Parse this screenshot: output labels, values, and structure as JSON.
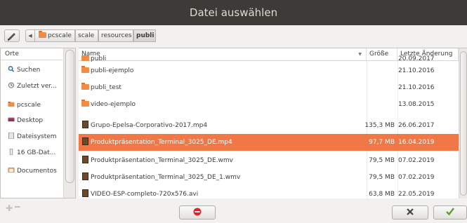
{
  "window": {
    "title": "Datei auswählen"
  },
  "pathbar": {
    "edit_icon": "pencil-icon",
    "back_icon": "chevron-left-icon",
    "crumbs": [
      "pcscale",
      "scale",
      "resources",
      "publi"
    ]
  },
  "sidebar": {
    "header": "Orte",
    "items": [
      {
        "label": "Suchen",
        "icon": "search-icon"
      },
      {
        "label": "Zuletzt ver...",
        "icon": "recent-icon"
      },
      {
        "label": "pcscale",
        "icon": "home-folder-icon"
      },
      {
        "label": "Desktop",
        "icon": "desktop-icon"
      },
      {
        "label": "Dateisystem",
        "icon": "harddisk-icon"
      },
      {
        "label": "16 GB-Dat...",
        "icon": "usb-drive-icon"
      },
      {
        "label": "Documentos",
        "icon": "documents-icon"
      }
    ],
    "add_icon": "plus-icon",
    "remove_icon": "minus-icon"
  },
  "filelist": {
    "columns": {
      "name": "Name",
      "size": "Größe",
      "modified": "Letzte Änderung"
    },
    "partial_row": {
      "name": "publi",
      "date": "20.09.2017"
    },
    "rows": [
      {
        "type": "folder",
        "name": "publi-ejemplo",
        "size": "",
        "date": "21.10.2016",
        "selected": false
      },
      {
        "type": "folder",
        "name": "publi_test",
        "size": "",
        "date": "21.10.2016",
        "selected": false
      },
      {
        "type": "folder",
        "name": "video-ejemplo",
        "size": "",
        "date": "13.08.2015",
        "selected": false
      },
      {
        "type": "video",
        "name": "Grupo-Epelsa-Corporativo-2017.mp4",
        "size": "135,3 MB",
        "date": "26.06.2017",
        "selected": false
      },
      {
        "type": "video",
        "name": "Produktpräsentation_Terminal_3025_DE.mp4",
        "size": "97,7 MB",
        "date": "16.04.2019",
        "selected": true
      },
      {
        "type": "video",
        "name": "Produktpräsentation_Terminal_3025_DE.wmv",
        "size": "79,5 MB",
        "date": "07.02.2019",
        "selected": false
      },
      {
        "type": "video",
        "name": "Produktpräsentation_Terminal_3025_DE_1.wmv",
        "size": "79,5 MB",
        "date": "07.02.2019",
        "selected": false
      },
      {
        "type": "video",
        "name": "VIDEO-ESP-completo-720x576.avi",
        "size": "63,8 MB",
        "date": "22.05.2019",
        "selected": false
      }
    ]
  },
  "buttons": {
    "delete_icon": "no-entry-icon",
    "cancel_icon": "cross-icon",
    "ok_icon": "checkmark-icon"
  },
  "colors": {
    "selection": "#f07746",
    "titlebar": "#3c3b37",
    "folder": "#f08c46"
  }
}
